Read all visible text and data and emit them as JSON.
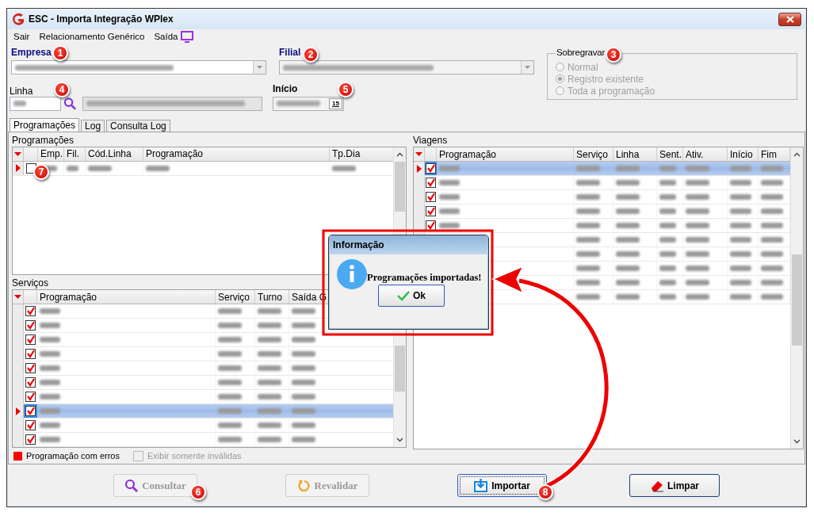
{
  "window": {
    "title": "ESC - Importa Integração WPlex"
  },
  "menu": [
    {
      "label": "Sair"
    },
    {
      "label": "Relacionamento Genérico"
    },
    {
      "label": "Saída"
    }
  ],
  "empresa": {
    "label": "Empresa"
  },
  "filial": {
    "label": "Filial"
  },
  "sobregravar": {
    "label": "Sobregravar",
    "disabled": true,
    "options": [
      {
        "label": "Normal",
        "selected": false
      },
      {
        "label": "Registro existente",
        "selected": true
      },
      {
        "label": "Toda a programação",
        "selected": false
      }
    ]
  },
  "linha": {
    "label": "Linha"
  },
  "inicio": {
    "label": "Início",
    "calendar_day": "15"
  },
  "tabs": [
    {
      "label": "Programações",
      "selected": true
    },
    {
      "label": "Log",
      "selected": false
    },
    {
      "label": "Consulta Log",
      "selected": false
    }
  ],
  "programacoes": {
    "title": "Programações",
    "columns": [
      "Emp.",
      "Fil.",
      "Cód.Linha",
      "Programação",
      "Tp.Dia"
    ],
    "rows": [
      {
        "checked": false,
        "current": true,
        "selected": false
      }
    ]
  },
  "servicos": {
    "title": "Serviços",
    "columns": [
      "Programação",
      "Serviço",
      "Turno",
      "Saída G"
    ],
    "rows": [
      {
        "checked": true,
        "current": false,
        "selected": false
      },
      {
        "checked": true,
        "current": false,
        "selected": false
      },
      {
        "checked": true,
        "current": false,
        "selected": false
      },
      {
        "checked": true,
        "current": false,
        "selected": false
      },
      {
        "checked": true,
        "current": false,
        "selected": false
      },
      {
        "checked": true,
        "current": false,
        "selected": false
      },
      {
        "checked": true,
        "current": false,
        "selected": false
      },
      {
        "checked": true,
        "current": true,
        "selected": true
      },
      {
        "checked": true,
        "current": false,
        "selected": false
      },
      {
        "checked": true,
        "current": false,
        "selected": false
      }
    ]
  },
  "viagens": {
    "title": "Viagens",
    "columns": [
      "Programação",
      "Serviço",
      "Linha",
      "Sent.",
      "Ativ.",
      "Início",
      "Fim"
    ],
    "rows": [
      {
        "checked": true,
        "current": true,
        "selected": true
      },
      {
        "checked": true,
        "current": false,
        "selected": false
      },
      {
        "checked": true,
        "current": false,
        "selected": false
      },
      {
        "checked": true,
        "current": false,
        "selected": false
      },
      {
        "checked": true,
        "current": false,
        "selected": false
      },
      {
        "selected": false
      },
      {
        "selected": false
      },
      {
        "selected": false
      },
      {
        "selected": false
      },
      {
        "selected": false
      }
    ]
  },
  "legend": {
    "label": "Programação com erros",
    "color": "#ff0000"
  },
  "only_invalid": {
    "label": "Exibir somente inválidas",
    "checked": false,
    "disabled": true
  },
  "buttons": [
    {
      "label": "Consultar",
      "kind": "search",
      "disabled": true,
      "focused": false
    },
    {
      "label": "Revalidar",
      "kind": "refresh",
      "disabled": true,
      "focused": false
    },
    {
      "label": "Importar",
      "kind": "import",
      "disabled": false,
      "focused": true
    },
    {
      "label": "Limpar",
      "kind": "eraser",
      "disabled": false,
      "focused": false
    }
  ],
  "dialog": {
    "title": "Informação",
    "message": "Programações importadas!",
    "button": "Ok"
  },
  "callouts": [
    "1",
    "2",
    "3",
    "4",
    "5",
    "6",
    "7",
    "8"
  ]
}
